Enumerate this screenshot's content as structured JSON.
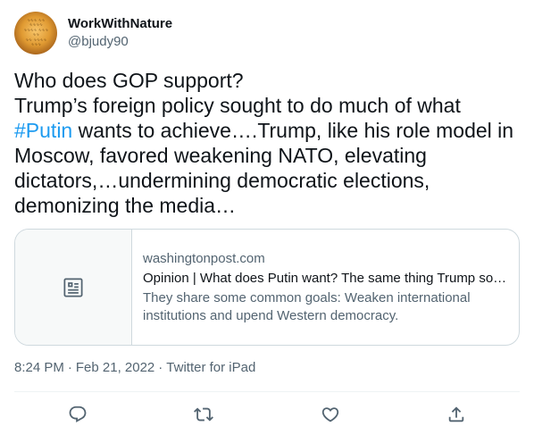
{
  "author": {
    "display_name": "WorkWithNature",
    "handle": "@bjudy90"
  },
  "tweet": {
    "line1": "Who does GOP support?",
    "line2_pre": "Trump’s foreign policy sought to do much of what ",
    "hashtag": "#Putin",
    "line2_post": " wants to achieve….Trump, like his role model in Moscow, favored weakening NATO, elevating dictators,…undermining democratic elections, demonizing the media…"
  },
  "card": {
    "domain": "washingtonpost.com",
    "title": "Opinion | What does Putin want? The same thing Trump sou…",
    "description": "They share some common goals: Weaken international institutions and upend Western democracy."
  },
  "meta": {
    "time": "8:24 PM",
    "date": "Feb 21, 2022",
    "source": "Twitter for iPad",
    "separator": "·"
  },
  "colors": {
    "link": "#1d9bf0",
    "secondary": "#536471",
    "text": "#0f1419",
    "border": "#cfd9de"
  },
  "icons": {
    "reply": "reply-icon",
    "retweet": "retweet-icon",
    "like": "like-icon",
    "share": "share-icon",
    "card_placeholder": "article-icon"
  }
}
